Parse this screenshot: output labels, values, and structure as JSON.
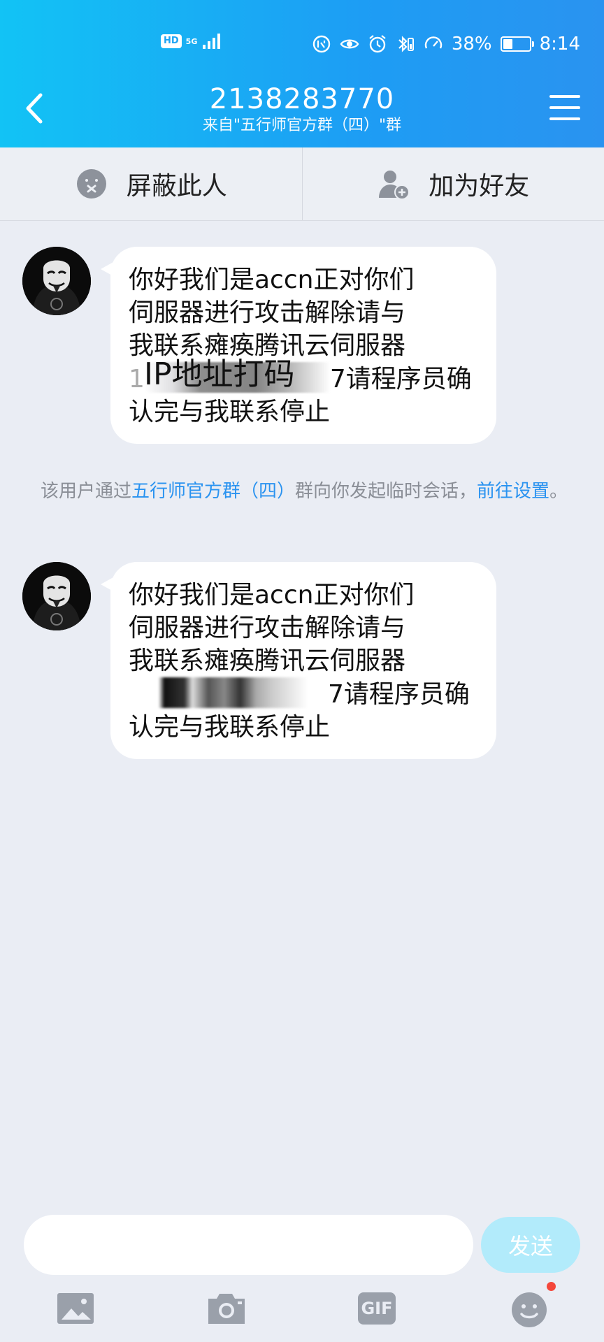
{
  "status_bar": {
    "hd_label": "HD",
    "network_label": "5G",
    "battery_text": "38%",
    "battery_level": 0.38,
    "time": "8:14"
  },
  "header": {
    "title": "2138283770",
    "subtitle": "来自\"五行师官方群（四）\"群",
    "back_icon": "chevron-left-icon",
    "menu_icon": "hamburger-menu-icon"
  },
  "actions": {
    "block_label": "屏蔽此人",
    "add_friend_label": "加为好友"
  },
  "messages": [
    {
      "line1": "你好我们是accn正对你们",
      "line2": "伺服器进行攻击解除请与",
      "line3": "我联系瘫痪腾讯云伺服器",
      "line4_prefix": "1",
      "line4_suffix": "7请程序员确",
      "line5": "认完与我联系停止",
      "overlay_text": "IP地址打码"
    },
    {
      "line1": "你好我们是accn正对你们",
      "line2": "伺服器进行攻击解除请与",
      "line3": "我联系瘫痪腾讯云伺服器",
      "line4_suffix": "7请程序员确",
      "line5": "认完与我联系停止"
    }
  ],
  "system_note": {
    "prefix": "该用户通过",
    "group_link": "五行师官方群（四）",
    "middle": "群向你发起临时会话，",
    "settings_link": "前往设置",
    "end": "。"
  },
  "composer": {
    "input_value": "",
    "send_label": "发送",
    "gif_label": "GIF"
  },
  "colors": {
    "header_start": "#12c3f5",
    "header_end": "#2a93f0",
    "link": "#2a93f0",
    "send_disabled": "#b2ebfb",
    "badge_dot": "#f4473b"
  }
}
